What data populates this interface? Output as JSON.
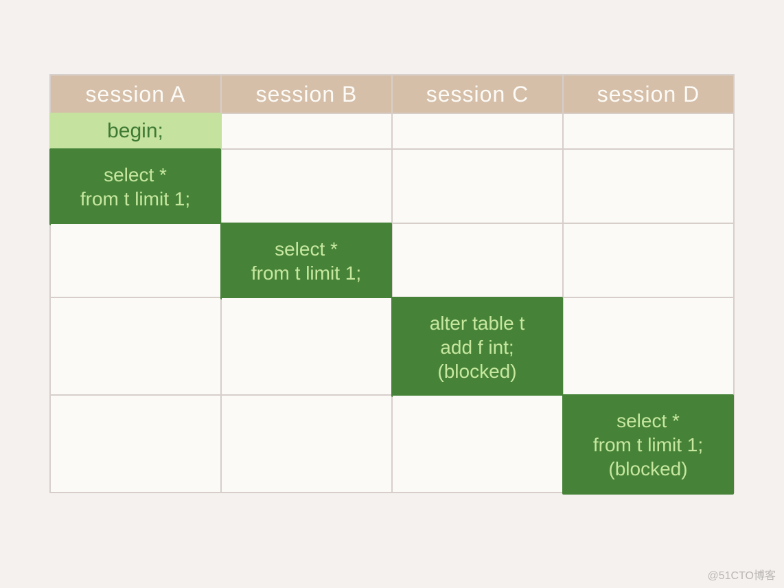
{
  "headers": [
    "session A",
    "session B",
    "session C",
    "session D"
  ],
  "cells": {
    "a_begin": "begin;",
    "a_select": "select *\nfrom t limit 1;",
    "b_select": "select *\nfrom t limit 1;",
    "c_alter": "alter table t\nadd f int;\n(blocked)",
    "d_select": "select *\nfrom t limit 1;\n(blocked)"
  },
  "watermark": "@51CTO博客"
}
